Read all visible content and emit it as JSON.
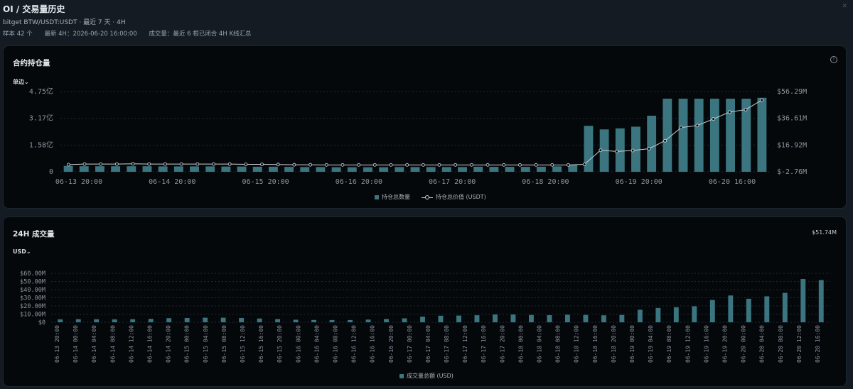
{
  "header": {
    "title": "OI / 交易量历史",
    "subtitle": "bitget BTW/USDT:USDT · 最近 7 天 · 4H",
    "samples": "样本 42 个",
    "latest": "最新 4H：2026-06-20 16:00:00",
    "volume_note": "成交量：最近 6 根已闭合 4H K线汇总"
  },
  "oi_panel": {
    "title": "合约持仓量",
    "unit_label": "单边",
    "legend_bars": "持仓总数量",
    "legend_line": "持仓总价值 (USDT)"
  },
  "vol_panel": {
    "title": "24H 成交量",
    "unit_label": "USD",
    "summary_value": "$51.74M",
    "legend_bars": "成交量总额 (USD)"
  },
  "colors": {
    "bar": "#3b7680",
    "line": "#c9ced3",
    "grid": "#1e2a33",
    "axis_text": "#8a949d"
  },
  "chart_data": [
    {
      "type": "bar",
      "title": "合约持仓量",
      "x_tick_labels": [
        "06-13 20:00",
        "06-14 20:00",
        "06-15 20:00",
        "06-16 20:00",
        "06-17 20:00",
        "06-18 20:00",
        "06-19 20:00",
        "06-20 16:00"
      ],
      "y_left_ticks": [
        "0",
        "1.58亿",
        "3.17亿",
        "4.75亿"
      ],
      "y_left_range": [
        0,
        4.75
      ],
      "y_right_ticks": [
        "$-2.76M",
        "$16.92M",
        "$36.61M",
        "$56.29M"
      ],
      "y_right_range": [
        -2.76,
        56.29
      ],
      "series": [
        {
          "name": "持仓总数量",
          "unit": "亿",
          "values": [
            0.35,
            0.33,
            0.33,
            0.33,
            0.33,
            0.33,
            0.32,
            0.32,
            0.32,
            0.32,
            0.31,
            0.31,
            0.3,
            0.3,
            0.29,
            0.28,
            0.28,
            0.27,
            0.27,
            0.27,
            0.27,
            0.28,
            0.28,
            0.28,
            0.28,
            0.28,
            0.3,
            0.29,
            0.29,
            0.29,
            0.3,
            0.32,
            0.41,
            2.72,
            2.51,
            2.57,
            2.67,
            3.32,
            4.33,
            4.33,
            4.33,
            4.33,
            4.33,
            4.33,
            4.38
          ]
        },
        {
          "name": "持仓总价值 (USDT)",
          "unit": "M",
          "values": [
            2.5,
            2.9,
            2.9,
            2.9,
            3.1,
            2.9,
            2.9,
            2.9,
            2.9,
            2.9,
            2.9,
            2.7,
            2.7,
            2.6,
            2.4,
            2.4,
            2.3,
            2.3,
            2.3,
            2.3,
            2.3,
            2.3,
            2.3,
            2.3,
            2.3,
            2.3,
            2.3,
            2.3,
            2.3,
            2.3,
            2.3,
            2.3,
            2.7,
            13.1,
            12.2,
            12.9,
            14.2,
            20.1,
            29.8,
            31.3,
            36.1,
            41.2,
            43.0,
            50.0
          ]
        }
      ]
    },
    {
      "type": "bar",
      "title": "24H 成交量",
      "categories": [
        "06-13 20:00",
        "06-14 00:00",
        "06-14 04:00",
        "06-14 08:00",
        "06-14 12:00",
        "06-14 16:00",
        "06-14 20:00",
        "06-15 00:00",
        "06-15 04:00",
        "06-15 08:00",
        "06-15 12:00",
        "06-15 16:00",
        "06-15 20:00",
        "06-16 00:00",
        "06-16 04:00",
        "06-16 08:00",
        "06-16 12:00",
        "06-16 16:00",
        "06-16 20:00",
        "06-17 00:00",
        "06-17 04:00",
        "06-17 08:00",
        "06-17 12:00",
        "06-17 16:00",
        "06-17 20:00",
        "06-18 00:00",
        "06-18 04:00",
        "06-18 08:00",
        "06-18 12:00",
        "06-18 16:00",
        "06-18 20:00",
        "06-19 00:00",
        "06-19 04:00",
        "06-19 08:00",
        "06-19 12:00",
        "06-19 16:00",
        "06-19 20:00",
        "06-20 00:00",
        "06-20 04:00",
        "06-20 08:00",
        "06-20 12:00",
        "06-20 16:00"
      ],
      "y_ticks": [
        "$0",
        "$10.00M",
        "$20.00M",
        "$30.00M",
        "$40.00M",
        "$50.00M",
        "$60.00M"
      ],
      "ylim": [
        0,
        60
      ],
      "series": [
        {
          "name": "成交量总额 (USD)",
          "unit": "M",
          "values": [
            3.6,
            3.8,
            3.7,
            3.6,
            3.8,
            4.2,
            5.0,
            5.2,
            5.6,
            5.6,
            5.2,
            4.6,
            3.9,
            3.1,
            2.8,
            2.7,
            2.7,
            3.3,
            4.0,
            4.8,
            6.9,
            8.0,
            8.2,
            8.6,
            9.5,
            9.5,
            9.0,
            8.7,
            9.2,
            9.0,
            8.5,
            9.0,
            15.4,
            17.5,
            18.4,
            19.6,
            27.3,
            32.8,
            28.8,
            31.8,
            36.0,
            53.0,
            51.7
          ]
        }
      ]
    }
  ]
}
